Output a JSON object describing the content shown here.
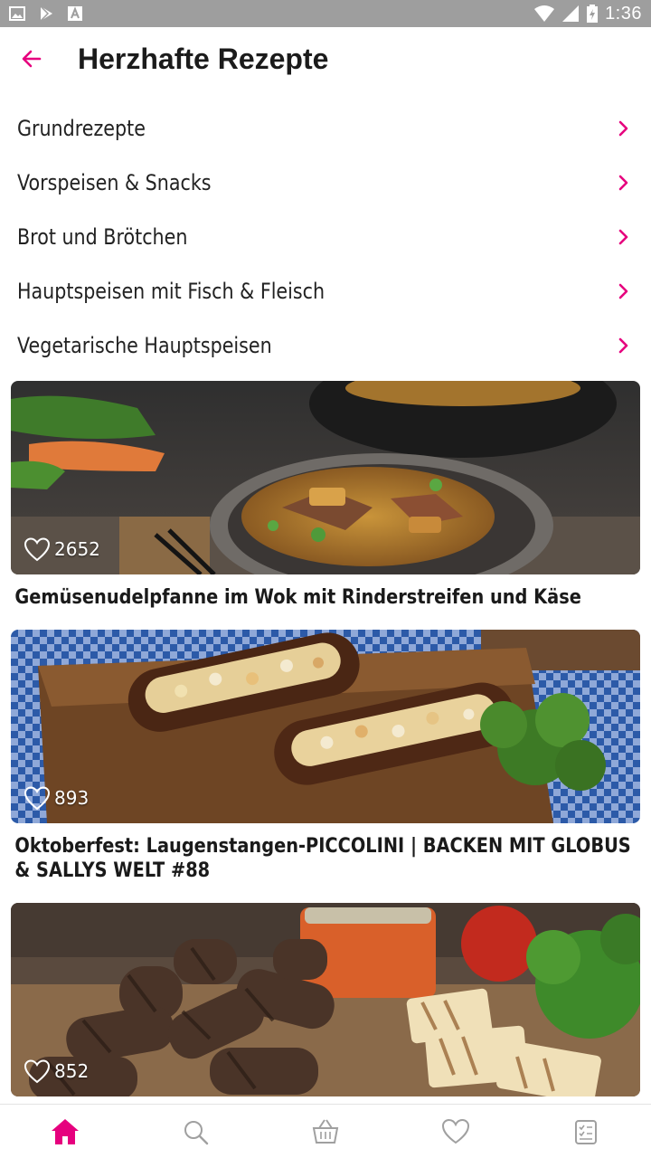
{
  "status_bar": {
    "time": "1:36",
    "left_icons": [
      "image-icon",
      "play-store-icon",
      "font-icon"
    ],
    "right_icons": [
      "wifi-icon",
      "signal-icon",
      "battery-icon"
    ]
  },
  "header": {
    "title": "Herzhafte Rezepte",
    "back_icon": "arrow-left-icon"
  },
  "categories": [
    {
      "label": "Grundrezepte"
    },
    {
      "label": "Vorspeisen & Snacks"
    },
    {
      "label": "Brot und Brötchen"
    },
    {
      "label": "Hauptspeisen mit Fisch & Fleisch"
    },
    {
      "label": "Vegetarische Hauptspeisen"
    }
  ],
  "recipes": [
    {
      "title": "Gemüsenudelpfanne im Wok mit Rinderstreifen und Käse",
      "likes": "2652"
    },
    {
      "title": "Oktoberfest: Laugenstangen-PICCOLINI | BACKEN MIT GLOBUS & SALLYS WELT #88",
      "likes": "893"
    },
    {
      "title": "",
      "likes": "852"
    }
  ],
  "bottom_nav": [
    {
      "name": "home",
      "icon": "home-icon",
      "active": true
    },
    {
      "name": "search",
      "icon": "search-icon",
      "active": false
    },
    {
      "name": "basket",
      "icon": "basket-icon",
      "active": false
    },
    {
      "name": "favorites",
      "icon": "heart-icon",
      "active": false
    },
    {
      "name": "shopping-list",
      "icon": "list-icon",
      "active": false
    }
  ],
  "colors": {
    "accent": "#e6007e",
    "status_bar": "#9e9e9e",
    "text": "#1b1b1b",
    "inactive_icon": "#a0a0a0"
  }
}
